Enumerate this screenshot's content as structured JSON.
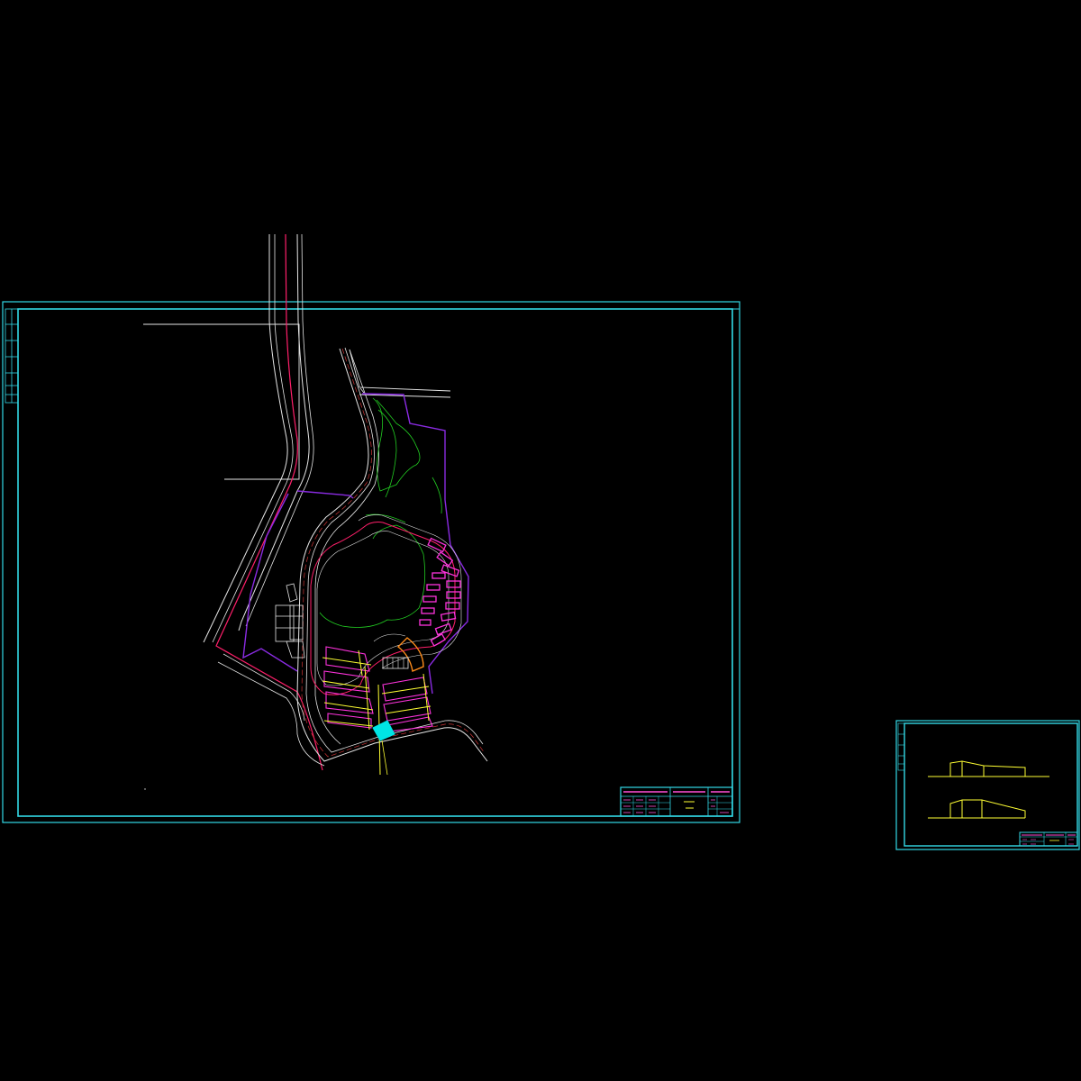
{
  "drawing": {
    "background": "#000000",
    "layer_colors": {
      "frame": "#33d9e6",
      "road": "#e6e6e6",
      "boundary": "#ff1f6a",
      "property_line": "#8a2be2",
      "green_line": "#22cc22",
      "building_outline": "#ff33dd",
      "building_fill_accent": "#ffff33",
      "road_centerline": "#cc3333",
      "plaza": "#00e5e5",
      "section": "#ffff33"
    },
    "sheets": [
      {
        "id": "main-site-plan",
        "kind": "site plan with title block"
      },
      {
        "id": "section-sheet",
        "kind": "terrain/section elevations with title block"
      }
    ]
  }
}
